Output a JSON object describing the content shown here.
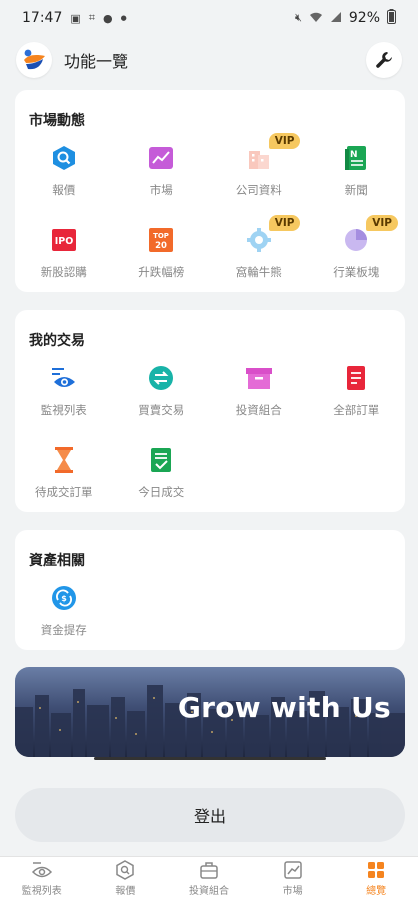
{
  "status_bar": {
    "time": "17:47",
    "battery": "92%"
  },
  "header": {
    "title": "功能一覽"
  },
  "sections": {
    "market": {
      "title": "市場動態",
      "items": [
        {
          "label": "報價",
          "icon": "quote-search-icon",
          "vip": false
        },
        {
          "label": "市場",
          "icon": "market-chart-icon",
          "vip": false
        },
        {
          "label": "公司資料",
          "icon": "company-info-icon",
          "vip": true
        },
        {
          "label": "新聞",
          "icon": "news-icon",
          "vip": false
        },
        {
          "label": "新股認購",
          "icon": "ipo-icon",
          "vip": false
        },
        {
          "label": "升跌幅榜",
          "icon": "top20-icon",
          "vip": false
        },
        {
          "label": "窩輪牛熊",
          "icon": "warrants-icon",
          "vip": true
        },
        {
          "label": "行業板塊",
          "icon": "sectors-pie-icon",
          "vip": true
        }
      ]
    },
    "trading": {
      "title": "我的交易",
      "items": [
        {
          "label": "監視列表",
          "icon": "watchlist-eye-icon"
        },
        {
          "label": "買賣交易",
          "icon": "trade-swap-icon"
        },
        {
          "label": "投資組合",
          "icon": "portfolio-box-icon"
        },
        {
          "label": "全部訂單",
          "icon": "all-orders-icon"
        },
        {
          "label": "待成交訂單",
          "icon": "pending-hourglass-icon"
        },
        {
          "label": "今日成交",
          "icon": "today-trades-icon"
        }
      ]
    },
    "assets": {
      "title": "資產相關",
      "items": [
        {
          "label": "資金提存",
          "icon": "fund-transfer-icon"
        }
      ]
    }
  },
  "vip_label": "VIP",
  "ipo_label": "IPO",
  "top20_label": "TOP 20",
  "banner": {
    "text": "Grow with Us"
  },
  "logout_label": "登出",
  "bottom_nav": [
    {
      "label": "監視列表",
      "icon": "eye-icon",
      "active": false
    },
    {
      "label": "報價",
      "icon": "quote-icon",
      "active": false
    },
    {
      "label": "投資組合",
      "icon": "briefcase-icon",
      "active": false
    },
    {
      "label": "市場",
      "icon": "chart-icon",
      "active": false
    },
    {
      "label": "總覽",
      "icon": "grid-icon",
      "active": true
    }
  ],
  "colors": {
    "accent": "#f5841f",
    "vip": "#f6c860",
    "blue": "#1e8fe1",
    "red": "#e8263a"
  }
}
